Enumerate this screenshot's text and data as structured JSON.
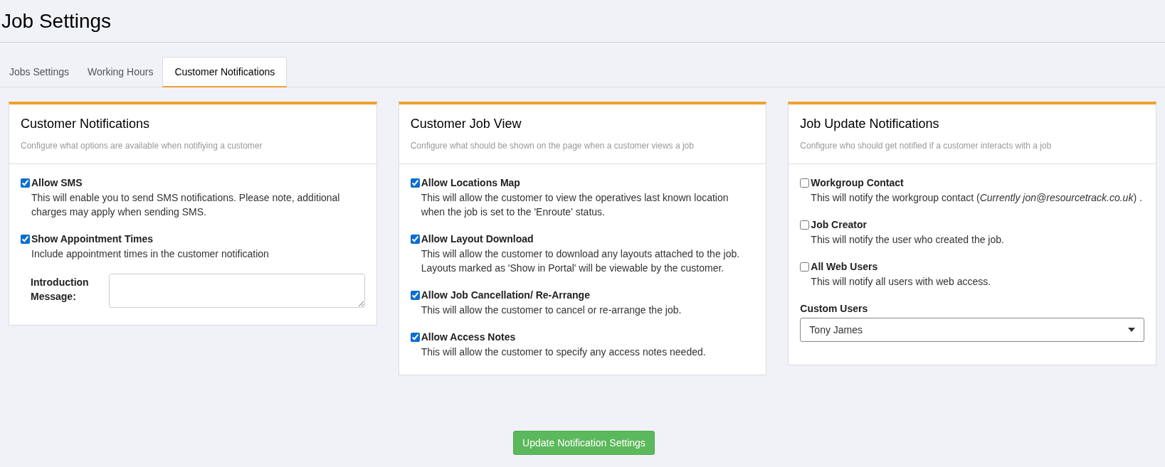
{
  "page_title": "Job Settings",
  "tabs": [
    {
      "label": "Jobs Settings",
      "selected": false
    },
    {
      "label": "Working Hours",
      "selected": false
    },
    {
      "label": "Customer Notifications",
      "selected": true
    }
  ],
  "panels": [
    {
      "title": "Customer Notifications",
      "subtitle": "Configure what options are available when notifiying a customer",
      "items": [
        {
          "kind": "checkbox",
          "label": "Allow SMS",
          "checked": true,
          "description": "This will enable you to send SMS notifications. Please note, additional charges may apply when sending SMS."
        },
        {
          "kind": "checkbox",
          "label": "Show Appointment Times",
          "checked": true,
          "description": "Include appointment times in the customer notification"
        },
        {
          "kind": "textarea",
          "label": "Introduction Message:"
        }
      ]
    },
    {
      "title": "Customer Job View",
      "subtitle": "Configure what should be shown on the page when a customer views a job",
      "items": [
        {
          "kind": "checkbox",
          "label": "Allow Locations Map",
          "checked": true,
          "description": "This will allow the customer to view the operatives last known location when the job is set to the 'Enroute' status."
        },
        {
          "kind": "checkbox",
          "label": "Allow Layout Download",
          "checked": true,
          "description": "This will allow the customer to download any layouts attached to the job. Layouts marked as 'Show in Portal' will be viewable by the customer."
        },
        {
          "kind": "checkbox",
          "label": "Allow Job Cancellation/ Re-Arrange",
          "checked": true,
          "description": "This will allow the customer to cancel or re-arrange the job."
        },
        {
          "kind": "checkbox",
          "label": "Allow Access Notes",
          "checked": true,
          "description": "This will allow the customer to specify any access notes needed."
        }
      ]
    },
    {
      "title": "Job Update Notifications",
      "subtitle": "Configure who should get notified if a customer interacts with a job",
      "items": [
        {
          "kind": "checkbox",
          "label": "Workgroup Contact",
          "checked": false,
          "description": "This will notify the workgroup contact (*Currently jon@resourcetrack.co.uk*) ."
        },
        {
          "kind": "checkbox",
          "label": "Job Creator",
          "checked": false,
          "description": "This will notify the user who created the job."
        },
        {
          "kind": "checkbox",
          "label": "All Web Users",
          "checked": false,
          "description": "This will notify all users with web access."
        },
        {
          "kind": "select",
          "label": "Custom Users",
          "value": "Tony James"
        }
      ]
    }
  ],
  "submit_button": "Update Notification Settings"
}
